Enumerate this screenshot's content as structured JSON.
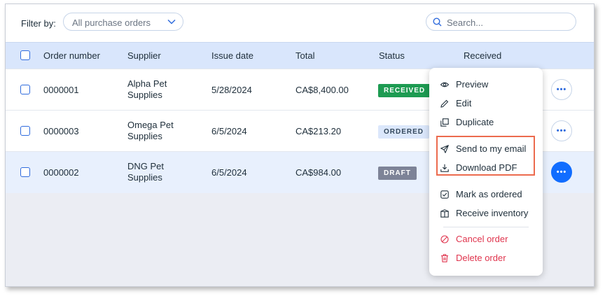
{
  "filter": {
    "label": "Filter by:",
    "selected": "All purchase orders"
  },
  "search": {
    "placeholder": "Search..."
  },
  "table": {
    "headers": [
      "Order number",
      "Supplier",
      "Issue date",
      "Total",
      "Status",
      "Received"
    ],
    "rows": [
      {
        "order": "0000001",
        "supplier_l1": "Alpha Pet",
        "supplier_l2": "Supplies",
        "date": "5/28/2024",
        "total": "CA$8,400.00",
        "status": "RECEIVED"
      },
      {
        "order": "0000003",
        "supplier_l1": "Omega Pet",
        "supplier_l2": "Supplies",
        "date": "6/5/2024",
        "total": "CA$213.20",
        "status": "ORDERED"
      },
      {
        "order": "0000002",
        "supplier_l1": "DNG Pet",
        "supplier_l2": "Supplies",
        "date": "6/5/2024",
        "total": "CA$984.00",
        "status": "DRAFT"
      }
    ],
    "more_label": "•••"
  },
  "menu": {
    "items": [
      {
        "label": "Preview",
        "icon": "eye-icon"
      },
      {
        "label": "Edit",
        "icon": "pencil-icon"
      },
      {
        "label": "Duplicate",
        "icon": "duplicate-icon"
      },
      {
        "label": "Send to my email",
        "icon": "send-icon"
      },
      {
        "label": "Download PDF",
        "icon": "download-icon"
      },
      {
        "label": "Mark as ordered",
        "icon": "mark-ordered-icon"
      },
      {
        "label": "Receive inventory",
        "icon": "receive-inventory-icon"
      },
      {
        "label": "Cancel order",
        "icon": "cancel-icon"
      },
      {
        "label": "Delete order",
        "icon": "trash-icon"
      }
    ]
  },
  "colors": {
    "accent": "#116dff",
    "received_bg": "#1d9b52",
    "ordered_bg": "#dbe7fb",
    "draft_bg": "#7d8397",
    "danger": "#e0354e",
    "highlight": "#ec6b4e"
  }
}
